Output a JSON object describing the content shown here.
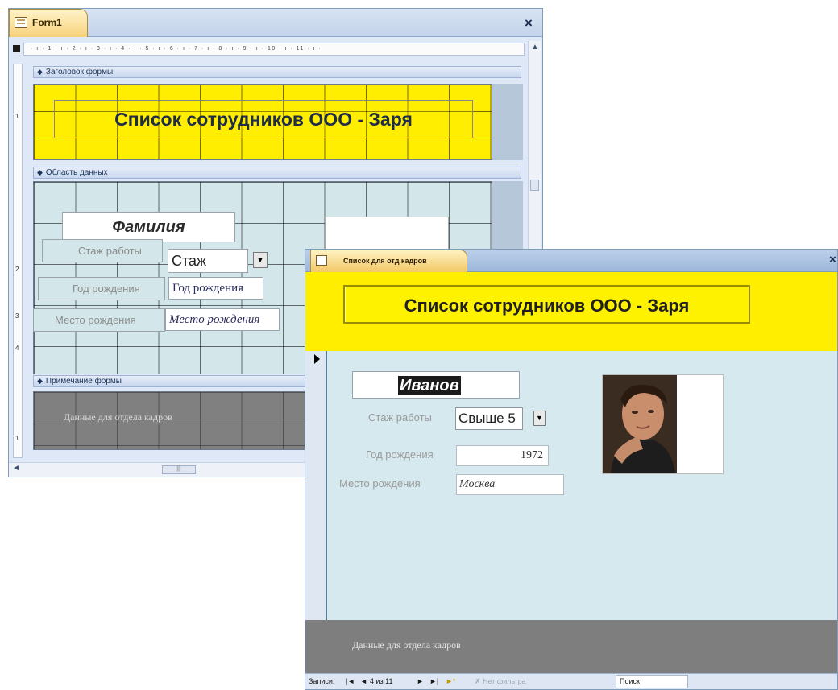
{
  "design_window": {
    "tab_title": "Form1",
    "close_glyph": "×",
    "ruler_text": "· ı · 1 · ı · 2 · ı · 3 · ı · 4 · ı · 5 · ı · 6 · ı · 7 · ı · 8 · ı · 9 · ı · 10 · ı · 11 · ı ·",
    "sections": {
      "header": "Заголовок формы",
      "detail": "Область данных",
      "footer": "Примечание формы"
    },
    "header_title": "Список сотрудников ООО - Заря",
    "fields": {
      "surname": "Фамилия",
      "experience_label": "Стаж работы",
      "experience_value": "Стаж",
      "birth_year_label": "Год рождения",
      "birth_year_value": "Год рождения",
      "birth_place_label": "Место рождения",
      "birth_place_value": "Место рождения"
    },
    "footer_text": "Данные для отдела кадров"
  },
  "form_window": {
    "tab_title": "Список для отд кадров",
    "close_glyph": "×",
    "header_title": "Список сотрудников ООО - Заря",
    "surname": "Иванов",
    "experience_label": "Стаж работы",
    "experience_value": "Свыше 5",
    "birth_year_label": "Год рождения",
    "birth_year_value": "1972",
    "birth_place_label": "Место рождения",
    "birth_place_value": "Москва",
    "footer_text": "Данные для отдела кадров"
  },
  "status_bar": {
    "records_label": "Записи:",
    "first": "◄",
    "prev": "◄",
    "position": "4 из 11",
    "next": "►",
    "last": "►",
    "new": "►*",
    "filter": "Нет фильтра",
    "search": "Поиск"
  },
  "colors": {
    "header_yellow": "#ffee00",
    "detail_bg": "#d5e9ee",
    "footer_gray": "#7e7e7e"
  },
  "icons": [
    "form-icon",
    "close-icon",
    "dropdown-arrow-icon",
    "record-selector-icon",
    "photo"
  ]
}
